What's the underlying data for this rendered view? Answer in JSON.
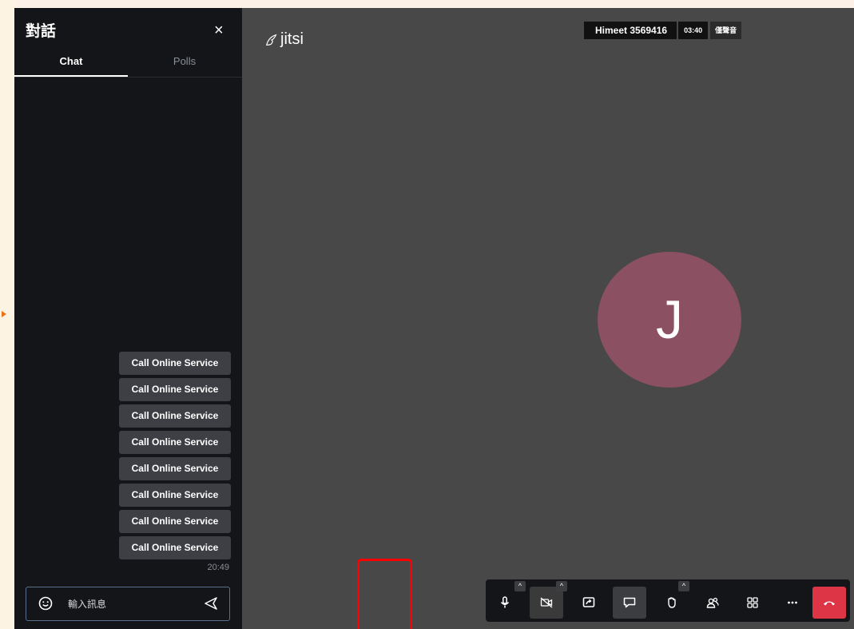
{
  "chat_panel": {
    "title": "對話",
    "close_label": "×",
    "tabs": [
      {
        "label": "Chat",
        "active": true
      },
      {
        "label": "Polls",
        "active": false
      }
    ],
    "messages": [
      "Call Online Service",
      "Call Online Service",
      "Call Online Service",
      "Call Online Service",
      "Call Online Service",
      "Call Online Service",
      "Call Online Service",
      "Call Online Service"
    ],
    "last_message_time": "20:49",
    "input": {
      "placeholder": "輸入訊息",
      "value": ""
    }
  },
  "stage": {
    "logo_text": "jitsi",
    "meeting_name": "Himeet 3569416",
    "timer": "03:40",
    "audio_only_badge": "僅聲音",
    "avatar_initial": "J",
    "avatar_color": "#8b5162"
  },
  "toolbar": {
    "buttons": [
      {
        "name": "microphone",
        "icon": "mic-icon"
      },
      {
        "name": "camera",
        "icon": "video-off-icon"
      },
      {
        "name": "share-screen",
        "icon": "screen-share-icon"
      },
      {
        "name": "chat",
        "icon": "chat-icon"
      },
      {
        "name": "raise-hand",
        "icon": "hand-icon"
      },
      {
        "name": "participants",
        "icon": "participants-icon"
      },
      {
        "name": "tile-view",
        "icon": "grid-icon"
      },
      {
        "name": "more",
        "icon": "more-icon"
      },
      {
        "name": "hang-up",
        "icon": "hangup-icon"
      }
    ],
    "hangup_color": "#dd3446",
    "highlight_color": "#ff0000"
  }
}
